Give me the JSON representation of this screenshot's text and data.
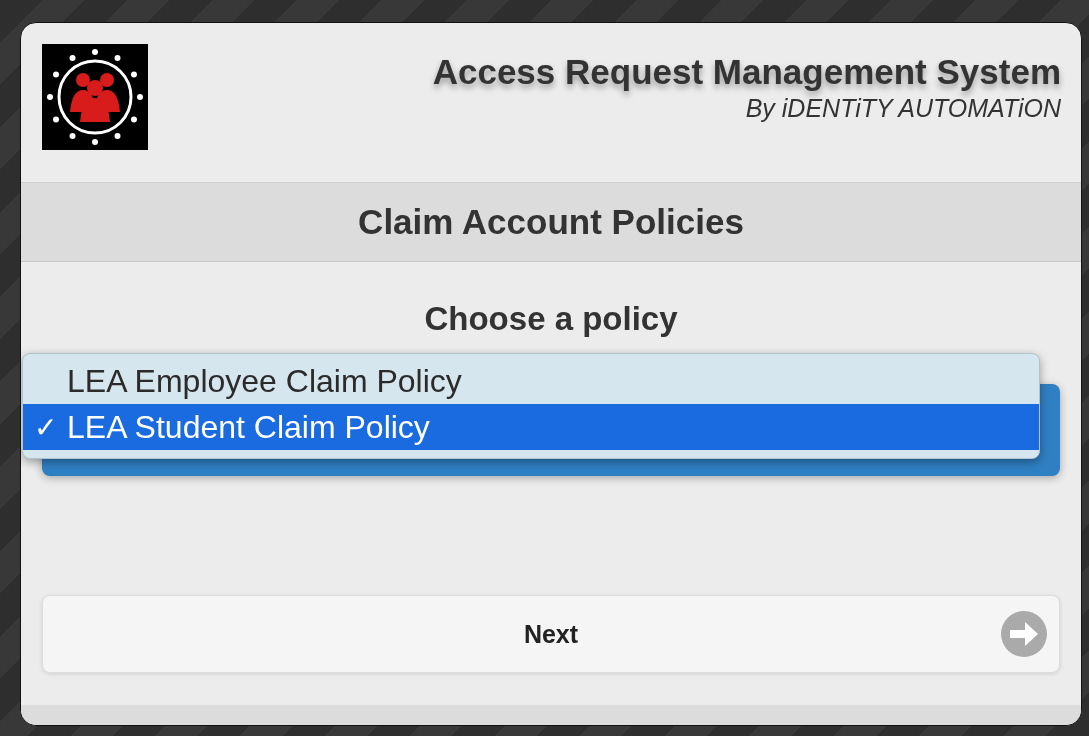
{
  "header": {
    "title": "Access Request Management System",
    "subtitle": "By iDENTiTY AUTOMATiON"
  },
  "page_title": "Claim Account Policies",
  "prompt": "Choose a policy",
  "policy_menu": {
    "check_mark": "✓",
    "options": [
      {
        "label": "LEA Employee Claim Policy",
        "selected": false
      },
      {
        "label": "LEA Student Claim Policy",
        "selected": true
      }
    ]
  },
  "next_button": {
    "label": "Next"
  }
}
